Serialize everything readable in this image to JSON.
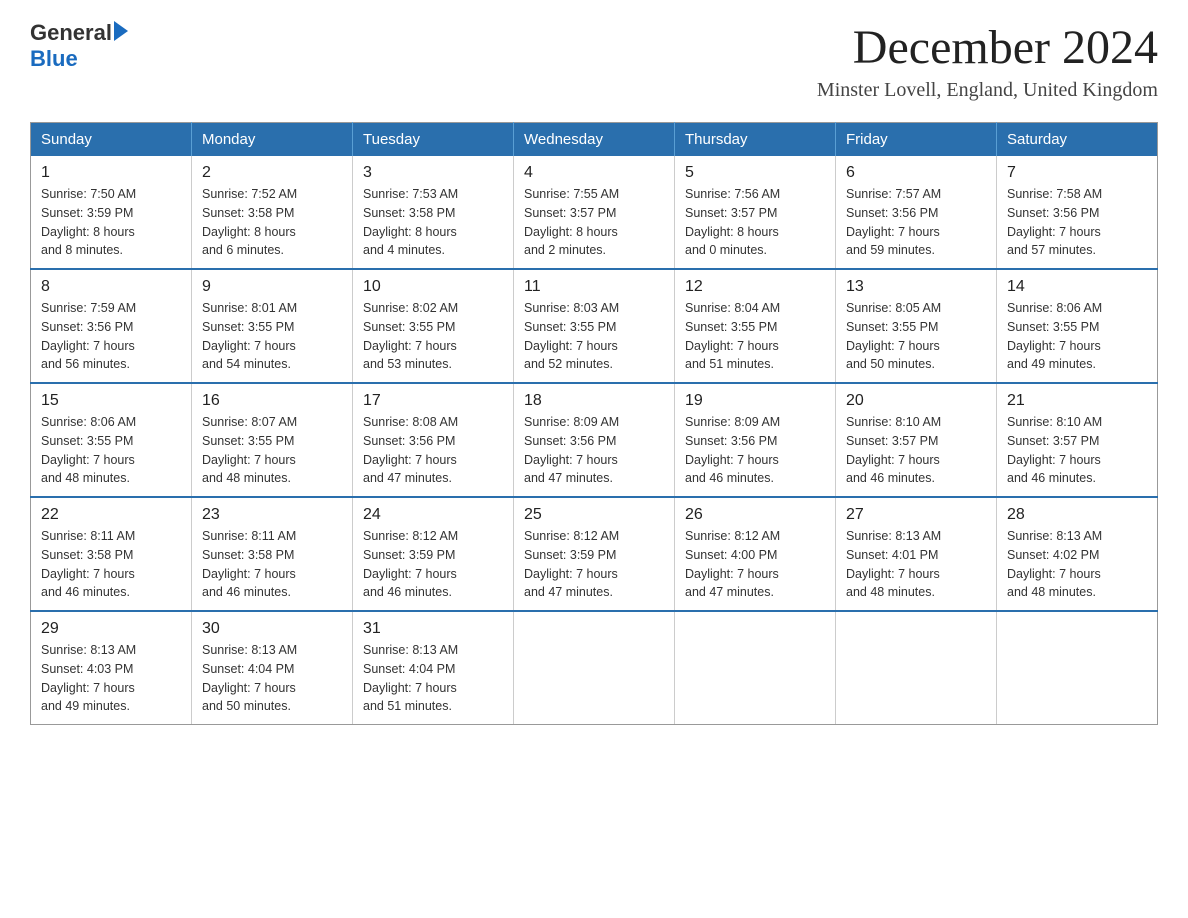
{
  "logo": {
    "general": "General",
    "blue": "Blue"
  },
  "title": "December 2024",
  "location": "Minster Lovell, England, United Kingdom",
  "days_of_week": [
    "Sunday",
    "Monday",
    "Tuesday",
    "Wednesday",
    "Thursday",
    "Friday",
    "Saturday"
  ],
  "weeks": [
    [
      {
        "day": "1",
        "sunrise": "7:50 AM",
        "sunset": "3:59 PM",
        "daylight": "8 hours and 8 minutes."
      },
      {
        "day": "2",
        "sunrise": "7:52 AM",
        "sunset": "3:58 PM",
        "daylight": "8 hours and 6 minutes."
      },
      {
        "day": "3",
        "sunrise": "7:53 AM",
        "sunset": "3:58 PM",
        "daylight": "8 hours and 4 minutes."
      },
      {
        "day": "4",
        "sunrise": "7:55 AM",
        "sunset": "3:57 PM",
        "daylight": "8 hours and 2 minutes."
      },
      {
        "day": "5",
        "sunrise": "7:56 AM",
        "sunset": "3:57 PM",
        "daylight": "8 hours and 0 minutes."
      },
      {
        "day": "6",
        "sunrise": "7:57 AM",
        "sunset": "3:56 PM",
        "daylight": "7 hours and 59 minutes."
      },
      {
        "day": "7",
        "sunrise": "7:58 AM",
        "sunset": "3:56 PM",
        "daylight": "7 hours and 57 minutes."
      }
    ],
    [
      {
        "day": "8",
        "sunrise": "7:59 AM",
        "sunset": "3:56 PM",
        "daylight": "7 hours and 56 minutes."
      },
      {
        "day": "9",
        "sunrise": "8:01 AM",
        "sunset": "3:55 PM",
        "daylight": "7 hours and 54 minutes."
      },
      {
        "day": "10",
        "sunrise": "8:02 AM",
        "sunset": "3:55 PM",
        "daylight": "7 hours and 53 minutes."
      },
      {
        "day": "11",
        "sunrise": "8:03 AM",
        "sunset": "3:55 PM",
        "daylight": "7 hours and 52 minutes."
      },
      {
        "day": "12",
        "sunrise": "8:04 AM",
        "sunset": "3:55 PM",
        "daylight": "7 hours and 51 minutes."
      },
      {
        "day": "13",
        "sunrise": "8:05 AM",
        "sunset": "3:55 PM",
        "daylight": "7 hours and 50 minutes."
      },
      {
        "day": "14",
        "sunrise": "8:06 AM",
        "sunset": "3:55 PM",
        "daylight": "7 hours and 49 minutes."
      }
    ],
    [
      {
        "day": "15",
        "sunrise": "8:06 AM",
        "sunset": "3:55 PM",
        "daylight": "7 hours and 48 minutes."
      },
      {
        "day": "16",
        "sunrise": "8:07 AM",
        "sunset": "3:55 PM",
        "daylight": "7 hours and 48 minutes."
      },
      {
        "day": "17",
        "sunrise": "8:08 AM",
        "sunset": "3:56 PM",
        "daylight": "7 hours and 47 minutes."
      },
      {
        "day": "18",
        "sunrise": "8:09 AM",
        "sunset": "3:56 PM",
        "daylight": "7 hours and 47 minutes."
      },
      {
        "day": "19",
        "sunrise": "8:09 AM",
        "sunset": "3:56 PM",
        "daylight": "7 hours and 46 minutes."
      },
      {
        "day": "20",
        "sunrise": "8:10 AM",
        "sunset": "3:57 PM",
        "daylight": "7 hours and 46 minutes."
      },
      {
        "day": "21",
        "sunrise": "8:10 AM",
        "sunset": "3:57 PM",
        "daylight": "7 hours and 46 minutes."
      }
    ],
    [
      {
        "day": "22",
        "sunrise": "8:11 AM",
        "sunset": "3:58 PM",
        "daylight": "7 hours and 46 minutes."
      },
      {
        "day": "23",
        "sunrise": "8:11 AM",
        "sunset": "3:58 PM",
        "daylight": "7 hours and 46 minutes."
      },
      {
        "day": "24",
        "sunrise": "8:12 AM",
        "sunset": "3:59 PM",
        "daylight": "7 hours and 46 minutes."
      },
      {
        "day": "25",
        "sunrise": "8:12 AM",
        "sunset": "3:59 PM",
        "daylight": "7 hours and 47 minutes."
      },
      {
        "day": "26",
        "sunrise": "8:12 AM",
        "sunset": "4:00 PM",
        "daylight": "7 hours and 47 minutes."
      },
      {
        "day": "27",
        "sunrise": "8:13 AM",
        "sunset": "4:01 PM",
        "daylight": "7 hours and 48 minutes."
      },
      {
        "day": "28",
        "sunrise": "8:13 AM",
        "sunset": "4:02 PM",
        "daylight": "7 hours and 48 minutes."
      }
    ],
    [
      {
        "day": "29",
        "sunrise": "8:13 AM",
        "sunset": "4:03 PM",
        "daylight": "7 hours and 49 minutes."
      },
      {
        "day": "30",
        "sunrise": "8:13 AM",
        "sunset": "4:04 PM",
        "daylight": "7 hours and 50 minutes."
      },
      {
        "day": "31",
        "sunrise": "8:13 AM",
        "sunset": "4:04 PM",
        "daylight": "7 hours and 51 minutes."
      },
      null,
      null,
      null,
      null
    ]
  ],
  "labels": {
    "sunrise": "Sunrise:",
    "sunset": "Sunset:",
    "daylight": "Daylight:"
  }
}
